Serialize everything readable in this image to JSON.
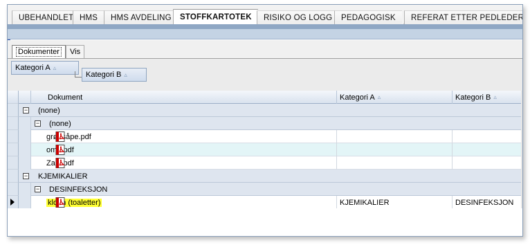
{
  "tabs": [
    {
      "label": "UBEHANDLET",
      "active": false
    },
    {
      "label": "HMS",
      "active": false
    },
    {
      "label": "HMS AVDELING",
      "active": false
    },
    {
      "label": "STOFFKARTOTEK",
      "active": true
    },
    {
      "label": "RISIKO OG LOGG",
      "active": false
    },
    {
      "label": "PEDAGOGISK",
      "active": false
    },
    {
      "label": "REFERAT ETTER PEDLEDERM",
      "active": false
    }
  ],
  "inner_tabs": [
    {
      "label": "Dokumenter",
      "active": true
    },
    {
      "label": "Vis",
      "active": false
    }
  ],
  "group_panel": {
    "group_a": "Kategori A",
    "group_b": "Kategori B",
    "sort_glyph": "▵"
  },
  "columns": {
    "dokument": "Dokument",
    "kategori_a": "Kategori A",
    "kategori_b": "Kategori B",
    "sort_glyph": "▵"
  },
  "groups": {
    "g1": {
      "label": "(none)",
      "expander": "−"
    },
    "g1_sub": {
      "label": "(none)",
      "expander": "−"
    },
    "g2": {
      "label": "KJEMIKALIER",
      "expander": "−"
    },
    "g2_sub": {
      "label": "DESINFEKSJON",
      "expander": "−"
    }
  },
  "rows": [
    {
      "name": "grønsåpe.pdf",
      "kategori_a": "",
      "kategori_b": ""
    },
    {
      "name": "omo.pdf",
      "kategori_a": "",
      "kategori_b": ""
    },
    {
      "name": "Zalo.pdf",
      "kategori_a": "",
      "kategori_b": ""
    },
    {
      "name": "klorin (toaletter)",
      "kategori_a": "KJEMIKALIER",
      "kategori_b": "DESINFEKSJON"
    }
  ],
  "colors": {
    "accent_blue": "#8fa7c4",
    "highlight": "#ffff33",
    "alt_row": "#e3f5f7"
  },
  "icons": {
    "document": "pdf-icon",
    "current_row": "row-pointer-icon"
  }
}
